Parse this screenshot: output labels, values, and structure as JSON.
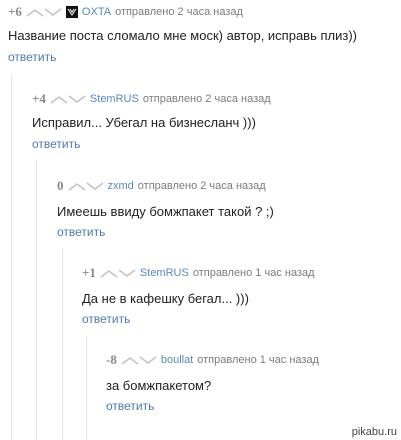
{
  "comments": [
    {
      "score": "+6",
      "author": "OXTA",
      "posted": "отправлено 2 часа назад",
      "text": "Название поста сломало мне моск) автор, исправь плиз))",
      "reply": "ответить",
      "avatar": true
    },
    {
      "score": "+4",
      "author": "StemRUS",
      "posted": "отправлено 2 часа назад",
      "text": "Исправил... Убегал на бизнесланч )))",
      "reply": "ответить",
      "avatar": false
    },
    {
      "score": "0",
      "author": "zxmd",
      "posted": "отправлено 2 часа назад",
      "text": "Имеешь ввиду бомжпакет такой ? ;)",
      "reply": "ответить",
      "avatar": false
    },
    {
      "score": "+1",
      "author": "StemRUS",
      "posted": "отправлено 1 час назад",
      "text": "Да не в кафешку бегал... )))",
      "reply": "ответить",
      "avatar": false
    },
    {
      "score": "-8",
      "author": "boullat",
      "posted": "отправлено 1 час назад",
      "text": "за бомжпакетом?",
      "reply": "ответить",
      "avatar": false
    }
  ],
  "watermark": "pikabu.ru",
  "colors": {
    "author": "#5a86c1",
    "reply": "#4d79b3",
    "score": "#8a8a8a",
    "thread_line": "#e6e6e6"
  }
}
